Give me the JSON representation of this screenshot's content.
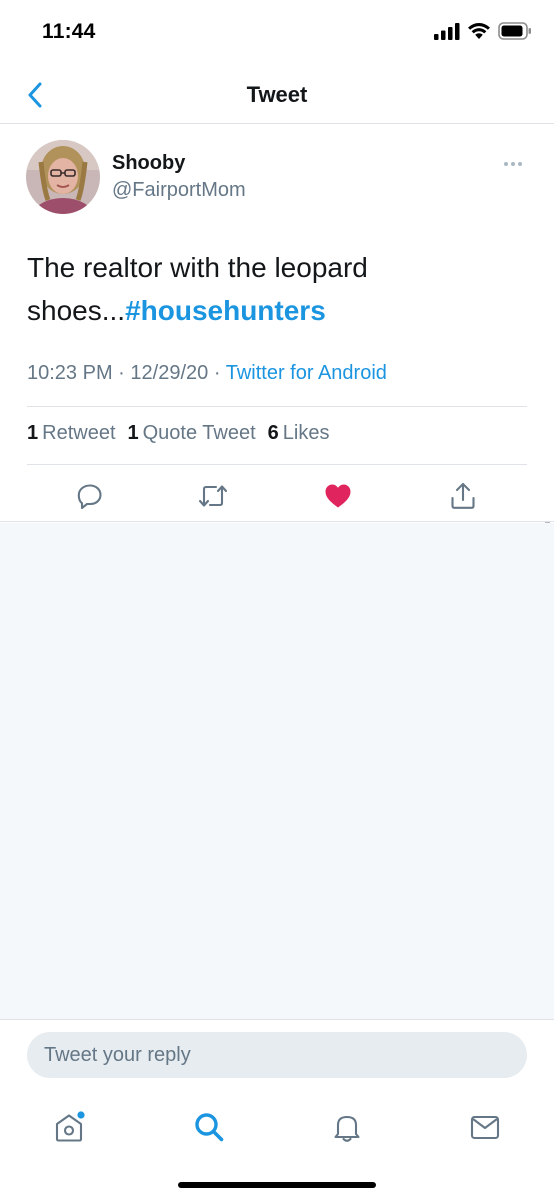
{
  "status_bar": {
    "time": "11:44"
  },
  "nav": {
    "title": "Tweet"
  },
  "tweet": {
    "display_name": "Shooby",
    "handle": "@FairportMom",
    "text_line1": "The realtor with the leopard",
    "text_line2_prefix": "shoes...",
    "hashtag": "#househunters",
    "time": "10:23 PM",
    "separator": "·",
    "date": "12/29/20",
    "source": "Twitter for Android",
    "stats": {
      "retweets_count": "1",
      "retweets_label": "Retweet",
      "quotes_count": "1",
      "quotes_label": "Quote Tweet",
      "likes_count": "6",
      "likes_label": "Likes"
    },
    "liked": true
  },
  "reply": {
    "placeholder": "Tweet your reply"
  },
  "tab_bar": {
    "items": [
      {
        "icon": "home-icon",
        "active": false,
        "badge": true
      },
      {
        "icon": "search-icon",
        "active": true
      },
      {
        "icon": "notifications-bell-icon",
        "active": false
      },
      {
        "icon": "messages-envelope-icon",
        "active": false
      }
    ]
  },
  "colors": {
    "accent": "#1b95e0",
    "like_red": "#e0245e",
    "secondary_text": "#657786",
    "primary_text": "#14171a",
    "background_gray": "#f5f8fa"
  }
}
